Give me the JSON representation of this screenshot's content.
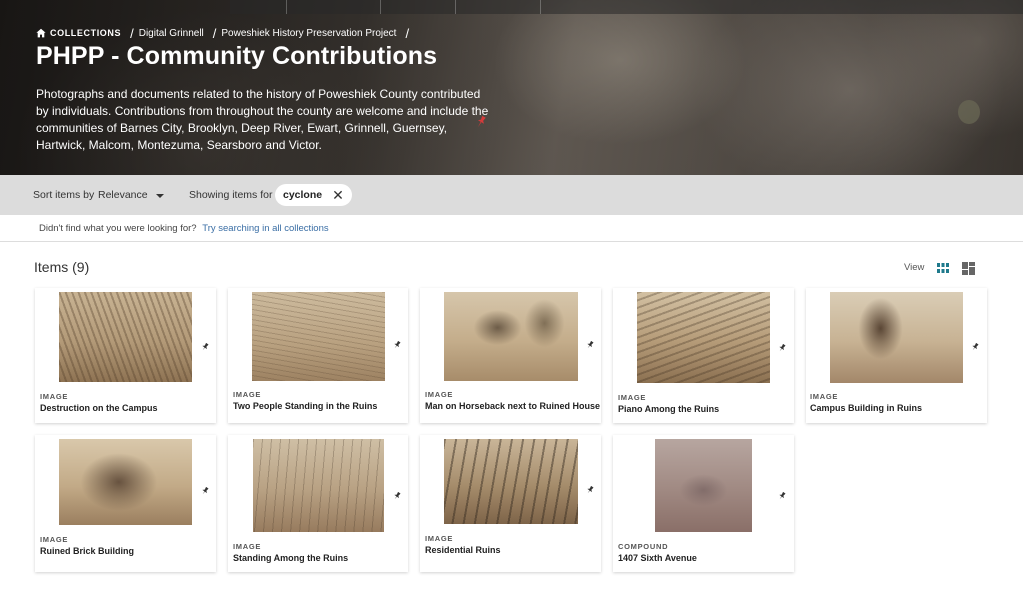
{
  "header": {
    "breadcrumbs": [
      {
        "label": "COLLECTIONS"
      },
      {
        "label": "Digital Grinnell"
      },
      {
        "label": "Poweshiek History Preservation Project"
      }
    ],
    "title": "PHPP - Community Contributions",
    "description": "Photographs and documents related to the history of Poweshiek County contributed by individuals. Contributions from throughout the county are welcome and include the communities of Barnes City, Brooklyn, Deep River, Ewart, Grinnell, Guernsey, Hartwick, Malcom, Montezuma, Searsboro and Victor."
  },
  "filters": {
    "sort_label": "Sort items by",
    "sort_value": "Relevance",
    "showing_label": "Showing items for",
    "search_term": "cyclone"
  },
  "suggestion": {
    "text": "Didn't find what you were looking for?",
    "link": "Try searching in all collections"
  },
  "items": {
    "heading": "Items (9)",
    "view_label": "View",
    "list": [
      {
        "type": "IMAGE",
        "title": "Destruction on the Campus"
      },
      {
        "type": "IMAGE",
        "title": "Two People Standing in the Ruins"
      },
      {
        "type": "IMAGE",
        "title": "Man on Horseback next to Ruined House"
      },
      {
        "type": "IMAGE",
        "title": "Piano Among the Ruins"
      },
      {
        "type": "IMAGE",
        "title": "Campus Building in Ruins"
      },
      {
        "type": "IMAGE",
        "title": "Ruined Brick Building"
      },
      {
        "type": "IMAGE",
        "title": "Standing Among the Ruins"
      },
      {
        "type": "IMAGE",
        "title": "Residential Ruins"
      },
      {
        "type": "COMPOUND",
        "title": "1407 Sixth Avenue"
      }
    ]
  },
  "colors": {
    "accent": "#1f7a8c",
    "link": "#3a6ea5",
    "filter_bar": "#dcdcdc"
  },
  "icons": {
    "home": "home-icon",
    "close": "close-icon",
    "grid_view": "grid-view-icon",
    "masonry_view": "masonry-view-icon",
    "pin": "pin-icon"
  }
}
